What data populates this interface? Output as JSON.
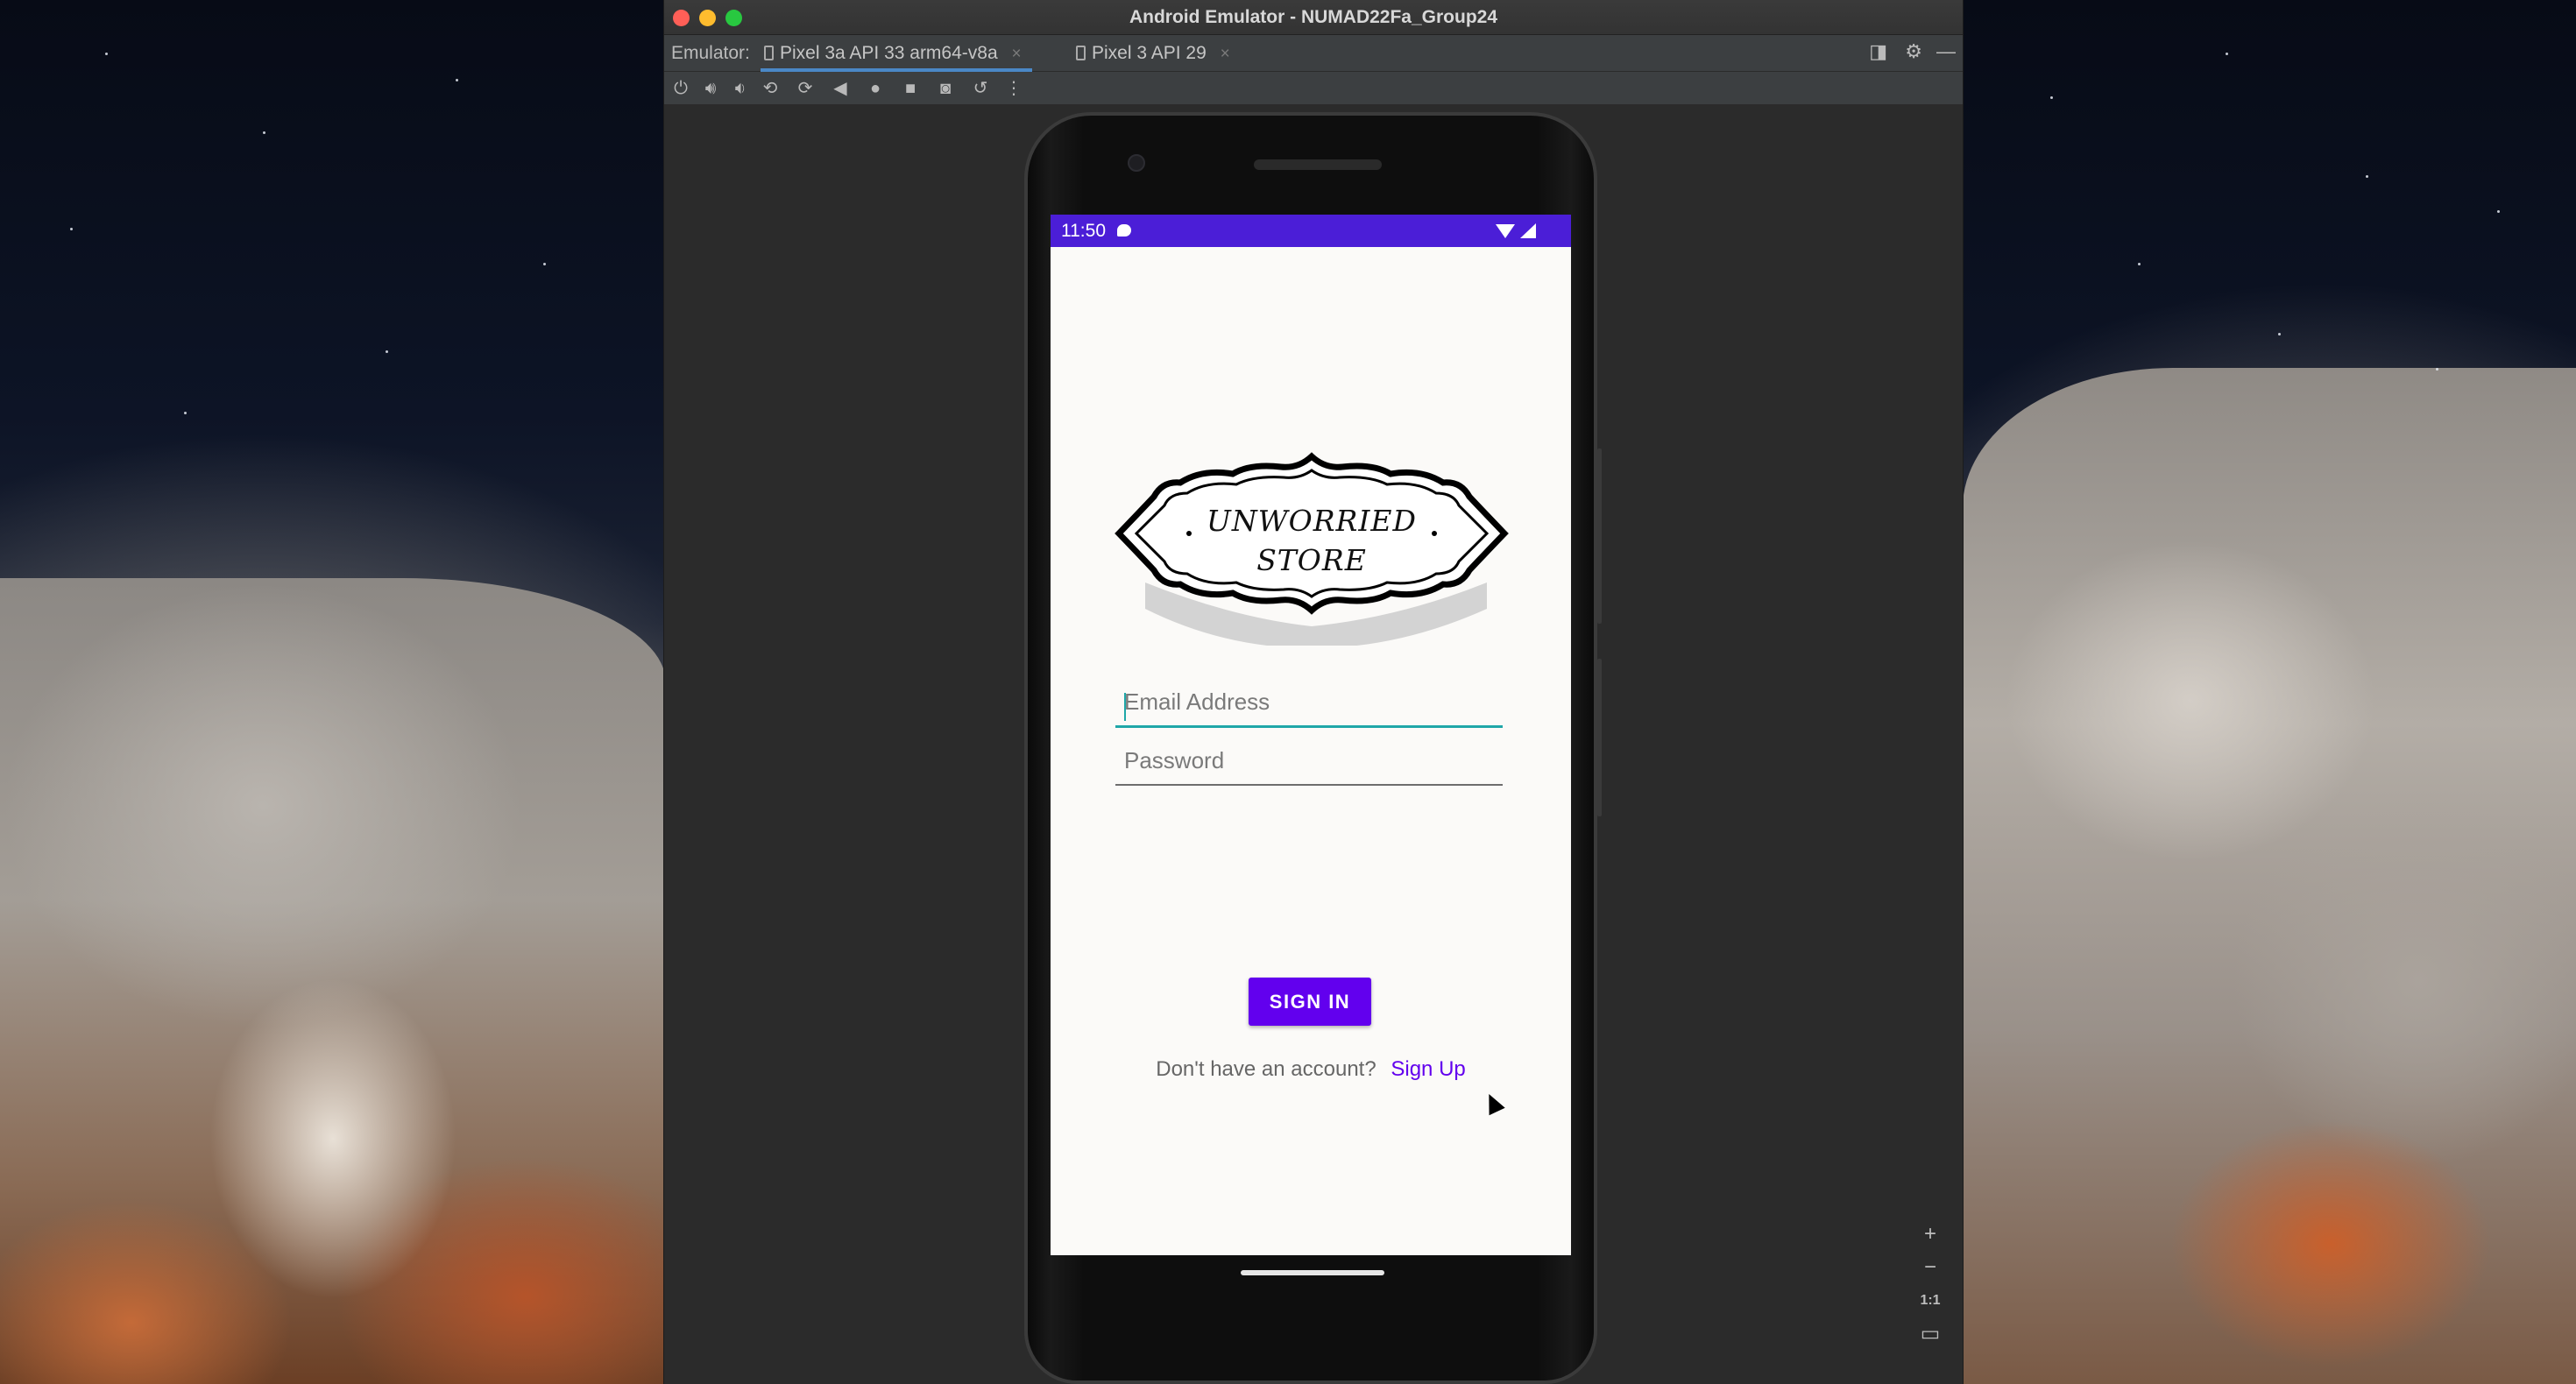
{
  "window": {
    "title": "Android Emulator - NUMAD22Fa_Group24"
  },
  "tabs": {
    "prefix": "Emulator:",
    "items": [
      {
        "label": "Pixel 3a API 33 arm64-v8a",
        "active": true
      },
      {
        "label": "Pixel 3 API 29",
        "active": false
      }
    ],
    "close_glyph": "×"
  },
  "toolbar": {
    "icons": [
      "power-icon",
      "volume-up-icon",
      "volume-down-icon",
      "rotate-left-icon",
      "rotate-right-icon",
      "back-icon",
      "home-icon",
      "overview-icon",
      "screenshot-icon",
      "snapshot-icon",
      "more-icon"
    ]
  },
  "zoom": {
    "zoom_in": "+",
    "zoom_out": "−",
    "actual_size": "1:1"
  },
  "status_bar": {
    "time": "11:50",
    "color": "#4b1ed7"
  },
  "app": {
    "logo_line1": "UNWORRIED",
    "logo_line2": "STORE",
    "email_placeholder": "Email Address",
    "password_placeholder": "Password",
    "sign_in_label": "SIGN IN",
    "no_account_text": "Don't have an account?",
    "sign_up_link": "Sign Up",
    "accent_color": "#6200ee",
    "focus_color": "#1fa7a8"
  }
}
